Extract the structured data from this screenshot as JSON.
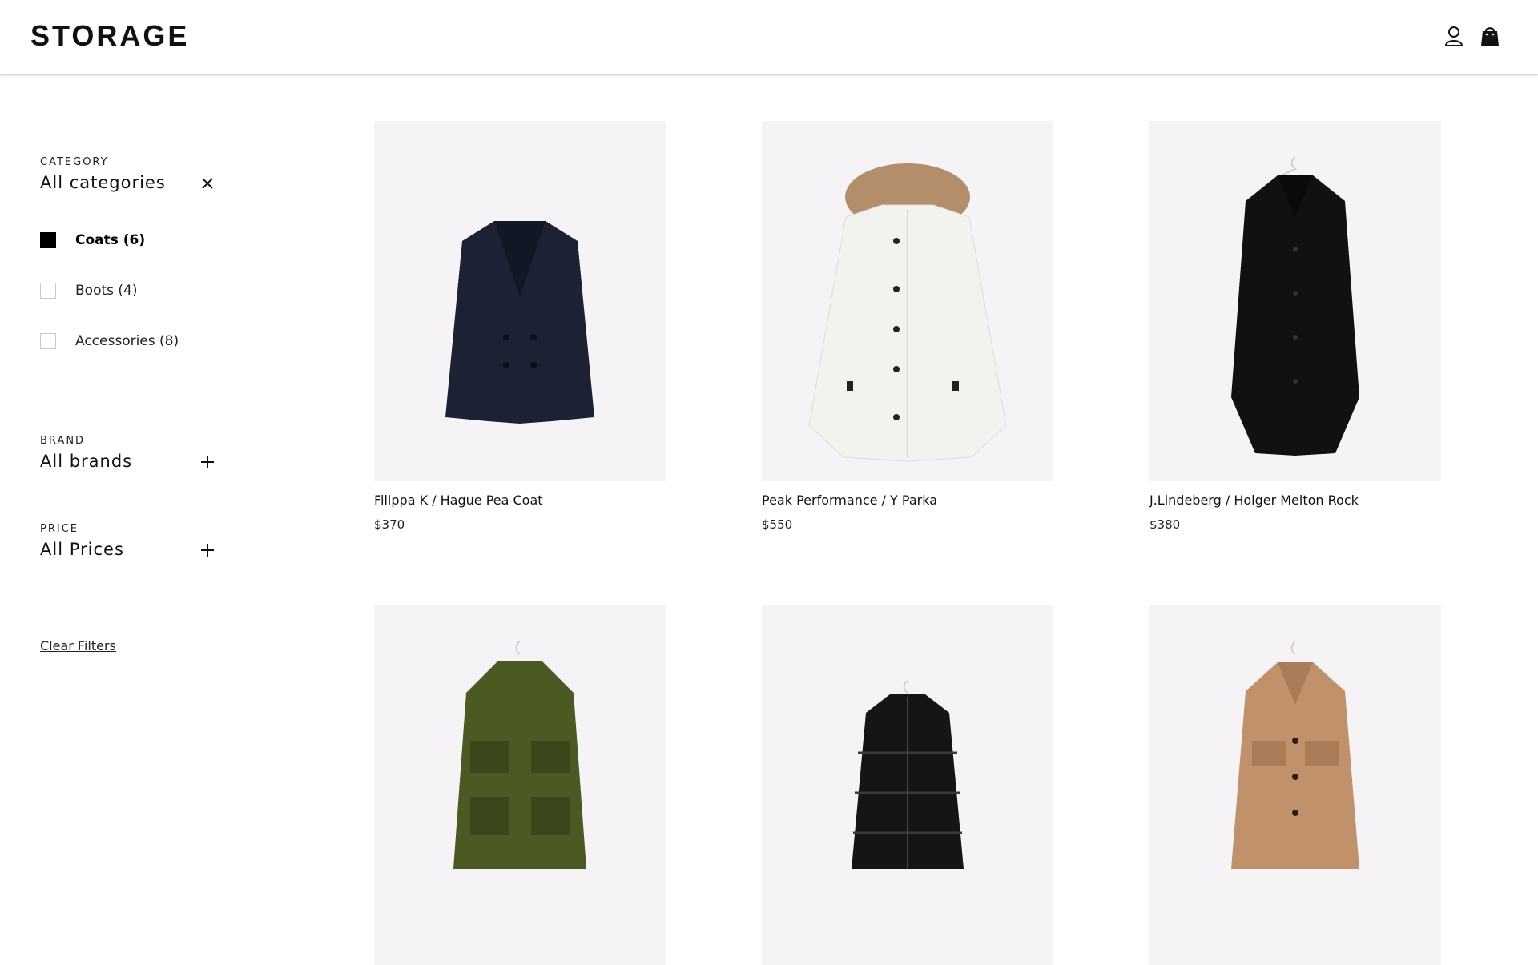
{
  "header": {
    "logo": "STORAGE",
    "account_icon": "account-icon",
    "bag_icon": "shopping-bag-icon"
  },
  "filters": {
    "category": {
      "eyebrow": "CATEGORY",
      "value": "All categories",
      "toggle_icon": "close-icon",
      "options": [
        {
          "label": "Coats (6)",
          "checked": true
        },
        {
          "label": "Boots (4)",
          "checked": false
        },
        {
          "label": "Accessories (8)",
          "checked": false
        }
      ]
    },
    "brand": {
      "eyebrow": "BRAND",
      "value": "All brands",
      "toggle_icon": "plus-icon"
    },
    "price": {
      "eyebrow": "PRICE",
      "value": "All Prices",
      "toggle_icon": "plus-icon"
    },
    "clear_label": "Clear Filters"
  },
  "products": [
    {
      "name": "Filippa K / Hague Pea Coat",
      "price": "$370",
      "color": "#1c2233",
      "image": "navy-pea-coat"
    },
    {
      "name": "Peak Performance / Y Parka",
      "price": "$550",
      "color": "#f2f2ef",
      "image": "white-parka-fur-hood"
    },
    {
      "name": "J.Lindeberg / Holger Melton Rock",
      "price": "$380",
      "color": "#111111",
      "image": "black-melton-coat"
    },
    {
      "name": "",
      "price": "",
      "color": "#4a5a22",
      "image": "green-field-jacket"
    },
    {
      "name": "",
      "price": "",
      "color": "#151515",
      "image": "black-puffer-jacket"
    },
    {
      "name": "",
      "price": "",
      "color": "#c0916a",
      "image": "camel-coat"
    }
  ]
}
